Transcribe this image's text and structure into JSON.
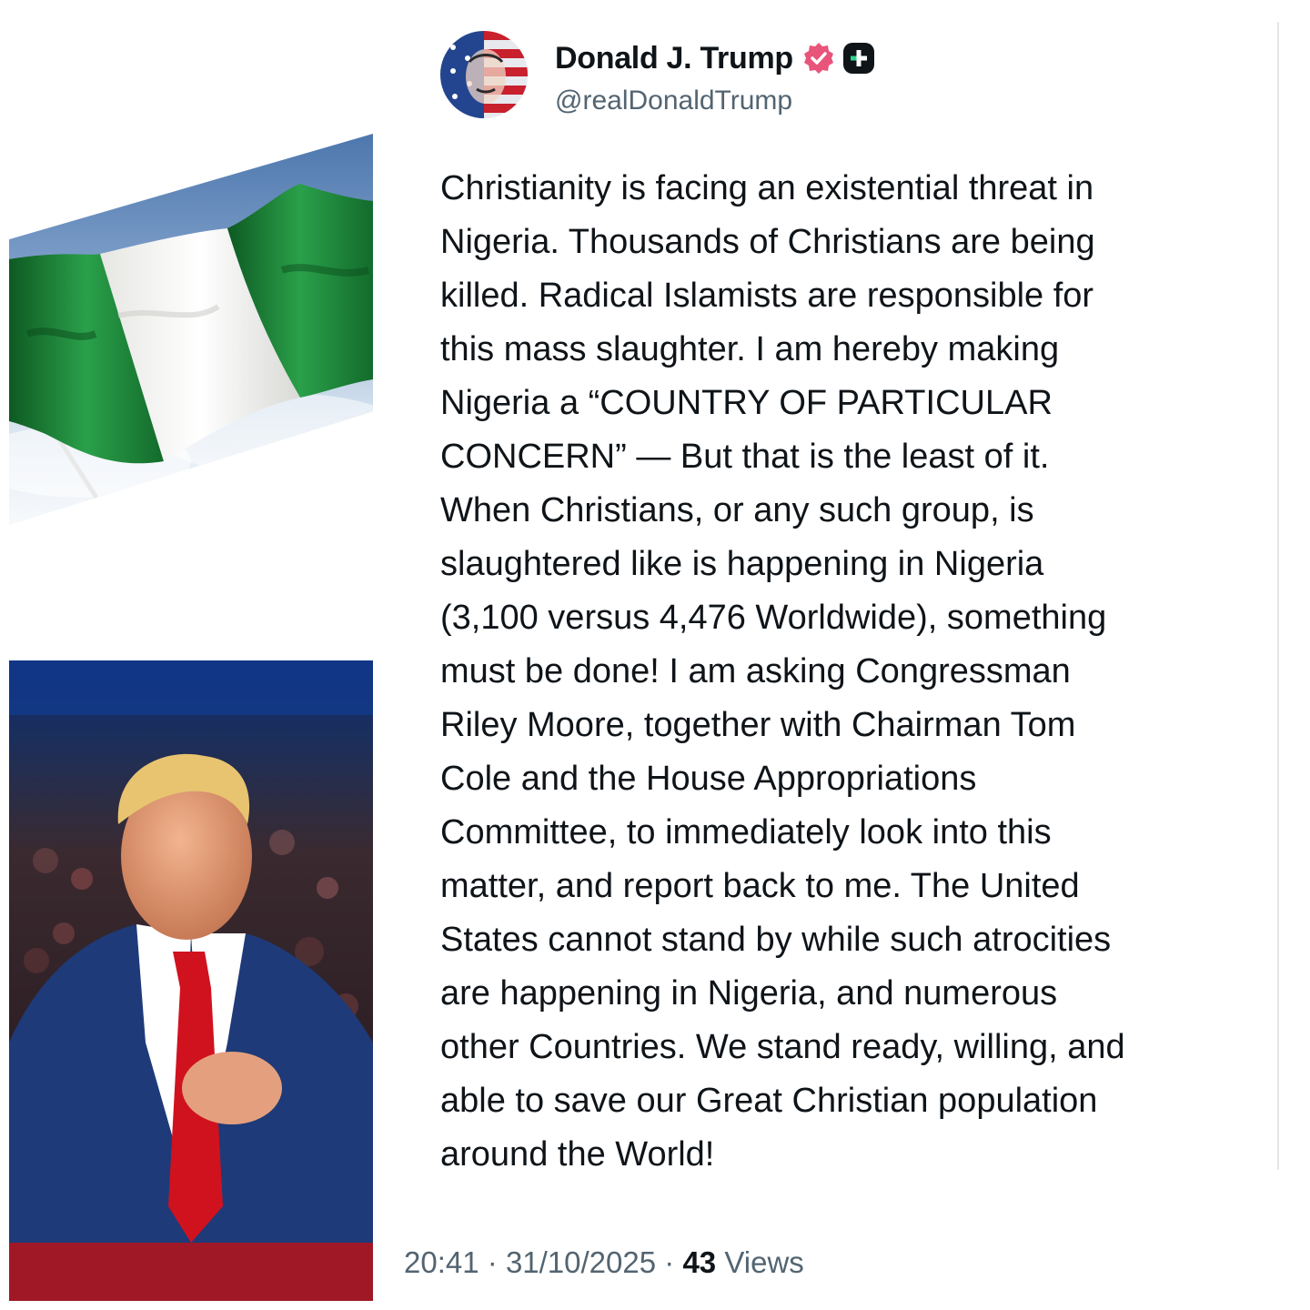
{
  "post": {
    "author": {
      "display_name": "Donald J. Trump",
      "handle": "@realDonaldTrump",
      "verified_icon": "verified-badge-icon",
      "plus_icon": "plus-badge-icon"
    },
    "body_lines": [
      "Christianity is facing an existential threat in",
      "Nigeria. Thousands of Christians are being",
      "killed. Radical Islamists are responsible for",
      "this mass slaughter. I am hereby making",
      "Nigeria a “COUNTRY OF PARTICULAR",
      "CONCERN” — But that is the least of it.",
      "When Christians, or any such group, is",
      "slaughtered like is happening in Nigeria",
      "(3,100 versus 4,476 Worldwide), something",
      "must be done! I am asking Congressman",
      "Riley Moore, together with Chairman Tom",
      "Cole and the House Appropriations",
      "Committee, to immediately look into this",
      "matter, and report back to me. The United",
      "States cannot stand by while such atrocities",
      "are happening in Nigeria, and numerous",
      "other Countries. We stand ready, willing, and",
      "able to save our Great Christian population",
      "around the World!"
    ],
    "meta": {
      "time": "20:41",
      "date": "31/10/2025",
      "separator": "·",
      "views_count": "43",
      "views_label": "Views"
    }
  },
  "colors": {
    "verified": "#e8547a",
    "secondary_text": "#536471",
    "flag_green": "#1f8a3a",
    "flag_white": "#f4f4f2",
    "tie_red": "#d0121f"
  }
}
